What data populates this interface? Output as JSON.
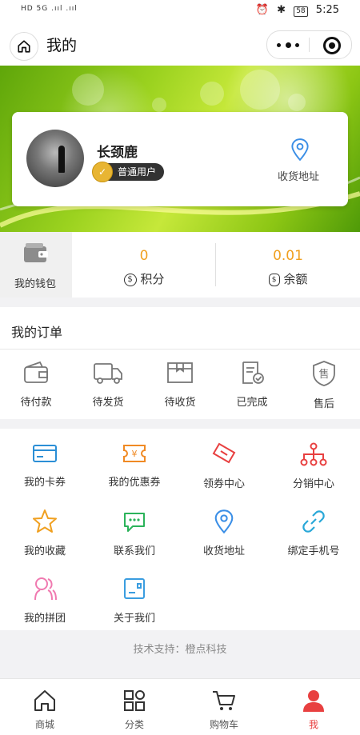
{
  "status_bar": {
    "left": "HD 5G .ııl .ııl",
    "alarm": "⏰",
    "bt": "✱",
    "battery": "58",
    "time": "5:25"
  },
  "nav": {
    "title": "我的"
  },
  "profile": {
    "username": "长颈鹿",
    "badge": "普通用户",
    "address_label": "收货地址"
  },
  "stats": {
    "wallet_label": "我的钱包",
    "points_value": "0",
    "points_label": "积分",
    "balance_value": "0.01",
    "balance_label": "余额"
  },
  "orders": {
    "title": "我的订单",
    "items": [
      {
        "label": "待付款",
        "icon": "wallet-icon"
      },
      {
        "label": "待发货",
        "icon": "truck-icon"
      },
      {
        "label": "待收货",
        "icon": "box-icon"
      },
      {
        "label": "已完成",
        "icon": "doc-check-icon"
      },
      {
        "label": "售后",
        "icon": "after-sale-icon"
      }
    ]
  },
  "services": [
    {
      "label": "我的卡券",
      "icon": "card-icon",
      "color": "#2b8fd6"
    },
    {
      "label": "我的优惠券",
      "icon": "coupon-icon",
      "color": "#f08a24"
    },
    {
      "label": "领券中心",
      "icon": "ticket-icon",
      "color": "#e84040"
    },
    {
      "label": "分销中心",
      "icon": "network-icon",
      "color": "#e84040"
    },
    {
      "label": "我的收藏",
      "icon": "star-icon",
      "color": "#f0a020"
    },
    {
      "label": "联系我们",
      "icon": "chat-icon",
      "color": "#2bb35a"
    },
    {
      "label": "收货地址",
      "icon": "location-icon",
      "color": "#3a8ee6"
    },
    {
      "label": "绑定手机号",
      "icon": "link-icon",
      "color": "#2aa8d8"
    },
    {
      "label": "我的拼团",
      "icon": "group-icon",
      "color": "#f07ab0"
    },
    {
      "label": "关于我们",
      "icon": "about-icon",
      "color": "#3a9de0"
    }
  ],
  "support_text": "技术支持：橙点科技",
  "tabs": [
    {
      "label": "商城",
      "icon": "home-icon"
    },
    {
      "label": "分类",
      "icon": "category-icon"
    },
    {
      "label": "购物车",
      "icon": "cart-icon"
    },
    {
      "label": "我",
      "icon": "user-icon"
    }
  ],
  "colors": {
    "accent": "#e84040",
    "points": "#f0a020"
  }
}
